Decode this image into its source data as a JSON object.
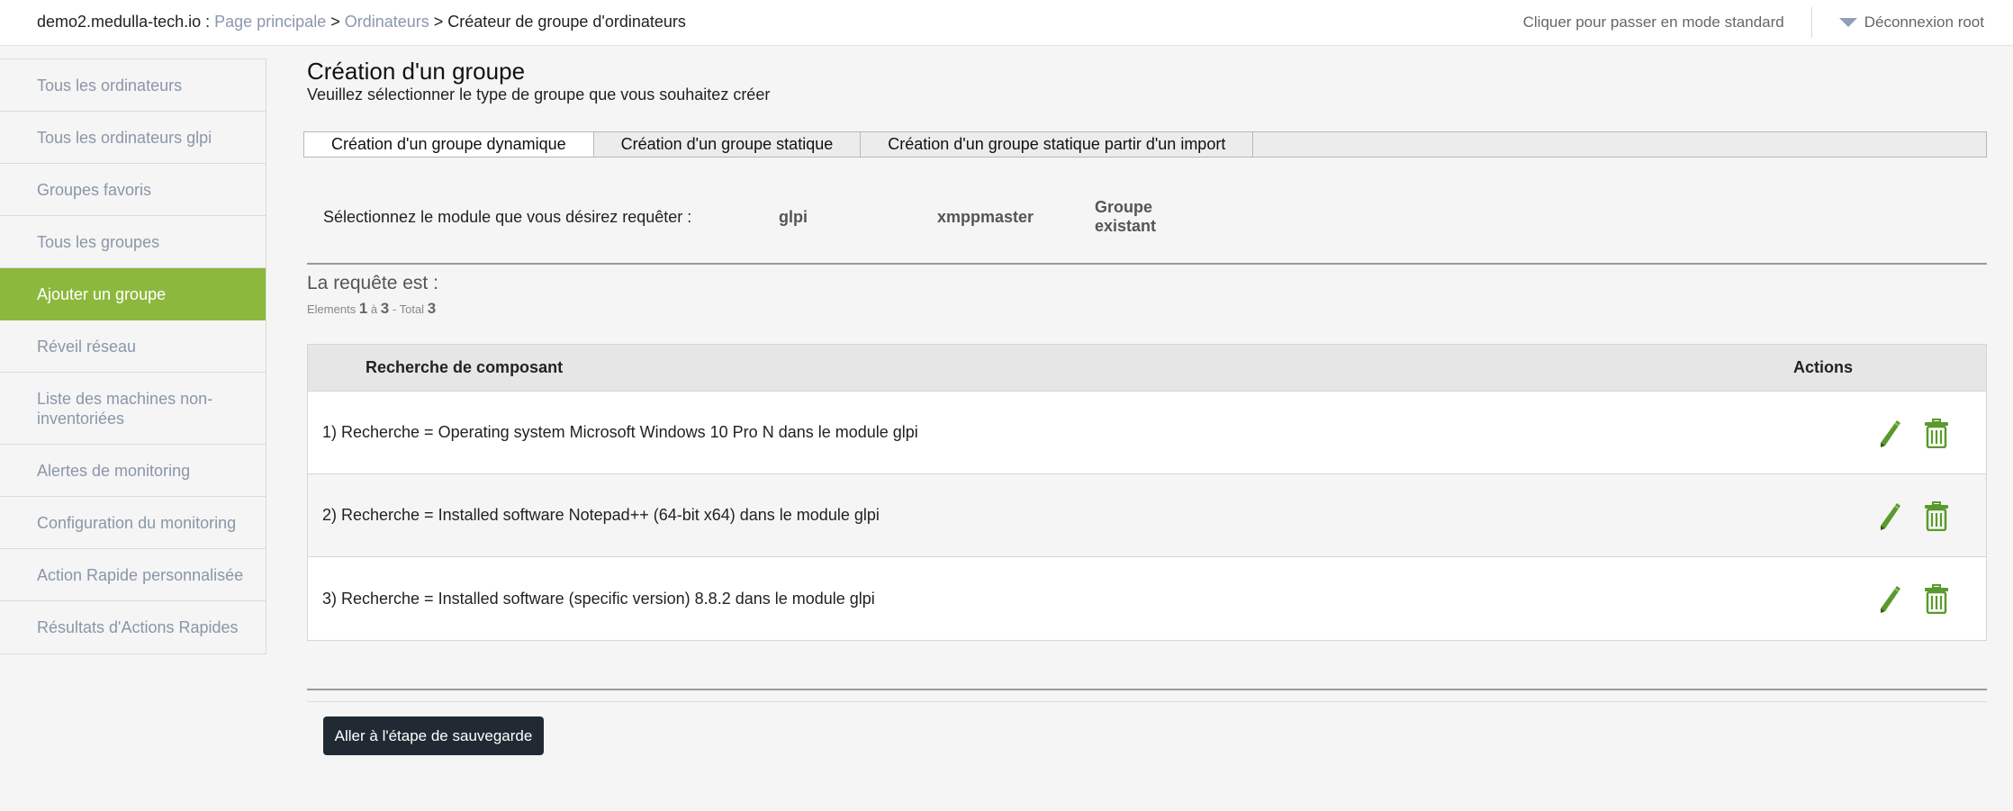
{
  "breadcrumb": {
    "host": "demo2.medulla-tech.io",
    "host_sep": " : ",
    "home": "Page principale",
    "sep1": " > ",
    "computers": "Ordinateurs",
    "sep2": " > ",
    "current": "Créateur de groupe d'ordinateurs"
  },
  "topbar": {
    "mode_link": "Cliquer pour passer en mode standard",
    "logout": "Déconnexion root"
  },
  "sidebar": {
    "items": [
      {
        "label": "Tous les ordinateurs"
      },
      {
        "label": "Tous les ordinateurs glpi"
      },
      {
        "label": "Groupes favoris"
      },
      {
        "label": "Tous les groupes"
      },
      {
        "label": "Ajouter un groupe"
      },
      {
        "label": "Réveil réseau"
      },
      {
        "label": "Liste des machines non-inventoriées"
      },
      {
        "label": "Alertes de monitoring"
      },
      {
        "label": "Configuration du monitoring"
      },
      {
        "label": "Action Rapide personnalisée"
      },
      {
        "label": "Résultats d'Actions Rapides"
      }
    ]
  },
  "page": {
    "title": "Création d'un groupe",
    "subtitle": "Veuillez sélectionner le type de groupe que vous souhaitez créer"
  },
  "tabs": [
    {
      "label": "Création d'un groupe dynamique"
    },
    {
      "label": "Création d'un groupe statique"
    },
    {
      "label": "Création d'un groupe statique partir d'un import"
    }
  ],
  "module": {
    "label": "Sélectionnez le module que vous désirez requêter :",
    "options": [
      "glpi",
      "xmppmaster"
    ],
    "existing_line1": "Groupe",
    "existing_line2": "existant"
  },
  "request": {
    "title": "La requête est :",
    "elements_label": "Elements",
    "from": "1",
    "to_label": "à",
    "to": "3",
    "total_sep": "-",
    "total_label": "Total",
    "total": "3"
  },
  "table": {
    "headers": {
      "component": "Recherche de composant",
      "actions": "Actions"
    },
    "rows": [
      {
        "text": "1) Recherche = Operating system Microsoft Windows 10 Pro N dans le module glpi"
      },
      {
        "text": "2) Recherche = Installed software Notepad++ (64-bit x64) dans le module glpi"
      },
      {
        "text": "3) Recherche = Installed software (specific version) 8.8.2 dans le module glpi"
      }
    ]
  },
  "actions": {
    "save_label": "Aller à l'étape de sauvegarde"
  },
  "icons": {
    "edit": "pencil-icon",
    "delete": "trash-icon",
    "logout": "caret-down-icon"
  },
  "colors": {
    "active_sidebar": "#8cb83d",
    "icon_green": "#5a9a2c",
    "button_dark": "#212a33"
  }
}
